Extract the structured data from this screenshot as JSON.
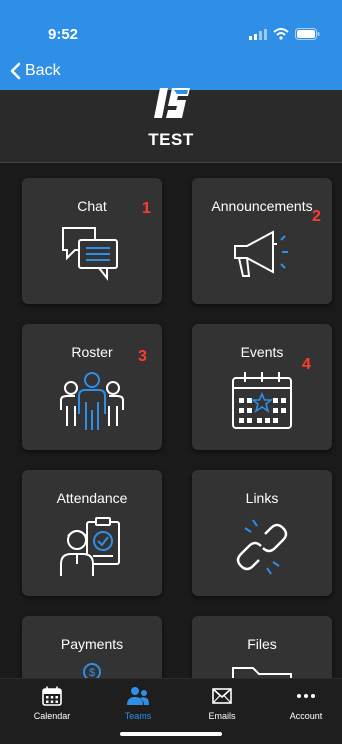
{
  "status": {
    "time": "9:52"
  },
  "nav": {
    "back_label": "Back"
  },
  "team": {
    "name": "TEST"
  },
  "tiles": [
    {
      "label": "Chat",
      "badge": "1"
    },
    {
      "label": "Announcements",
      "badge": "2"
    },
    {
      "label": "Roster",
      "badge": "3"
    },
    {
      "label": "Events",
      "badge": "4"
    },
    {
      "label": "Attendance",
      "badge": ""
    },
    {
      "label": "Links",
      "badge": ""
    },
    {
      "label": "Payments",
      "badge": ""
    },
    {
      "label": "Files",
      "badge": ""
    }
  ],
  "tabbar": {
    "items": [
      {
        "label": "Calendar",
        "icon": "calendar-icon"
      },
      {
        "label": "Teams",
        "icon": "people-icon",
        "active": true
      },
      {
        "label": "Emails",
        "icon": "mail-icon"
      },
      {
        "label": "Account",
        "icon": "more-icon"
      }
    ]
  },
  "colors": {
    "accent": "#2f8ee6",
    "badge": "#ff3b30",
    "tile": "#333333",
    "background": "#1b1b1b"
  }
}
